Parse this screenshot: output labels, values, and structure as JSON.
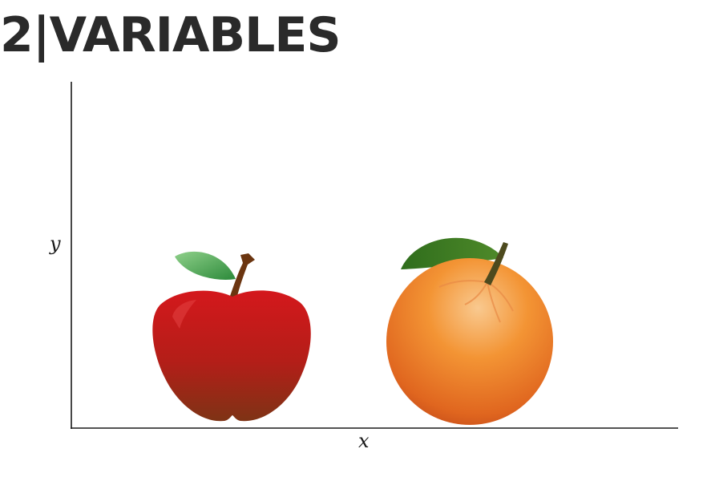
{
  "title": "2|VARIABLES",
  "axes": {
    "x_label": "x",
    "y_label": "y"
  },
  "items": [
    {
      "name": "apple",
      "icon": "apple-icon",
      "color": "#c81a1a"
    },
    {
      "name": "orange",
      "icon": "orange-icon",
      "color": "#f08a30"
    }
  ]
}
